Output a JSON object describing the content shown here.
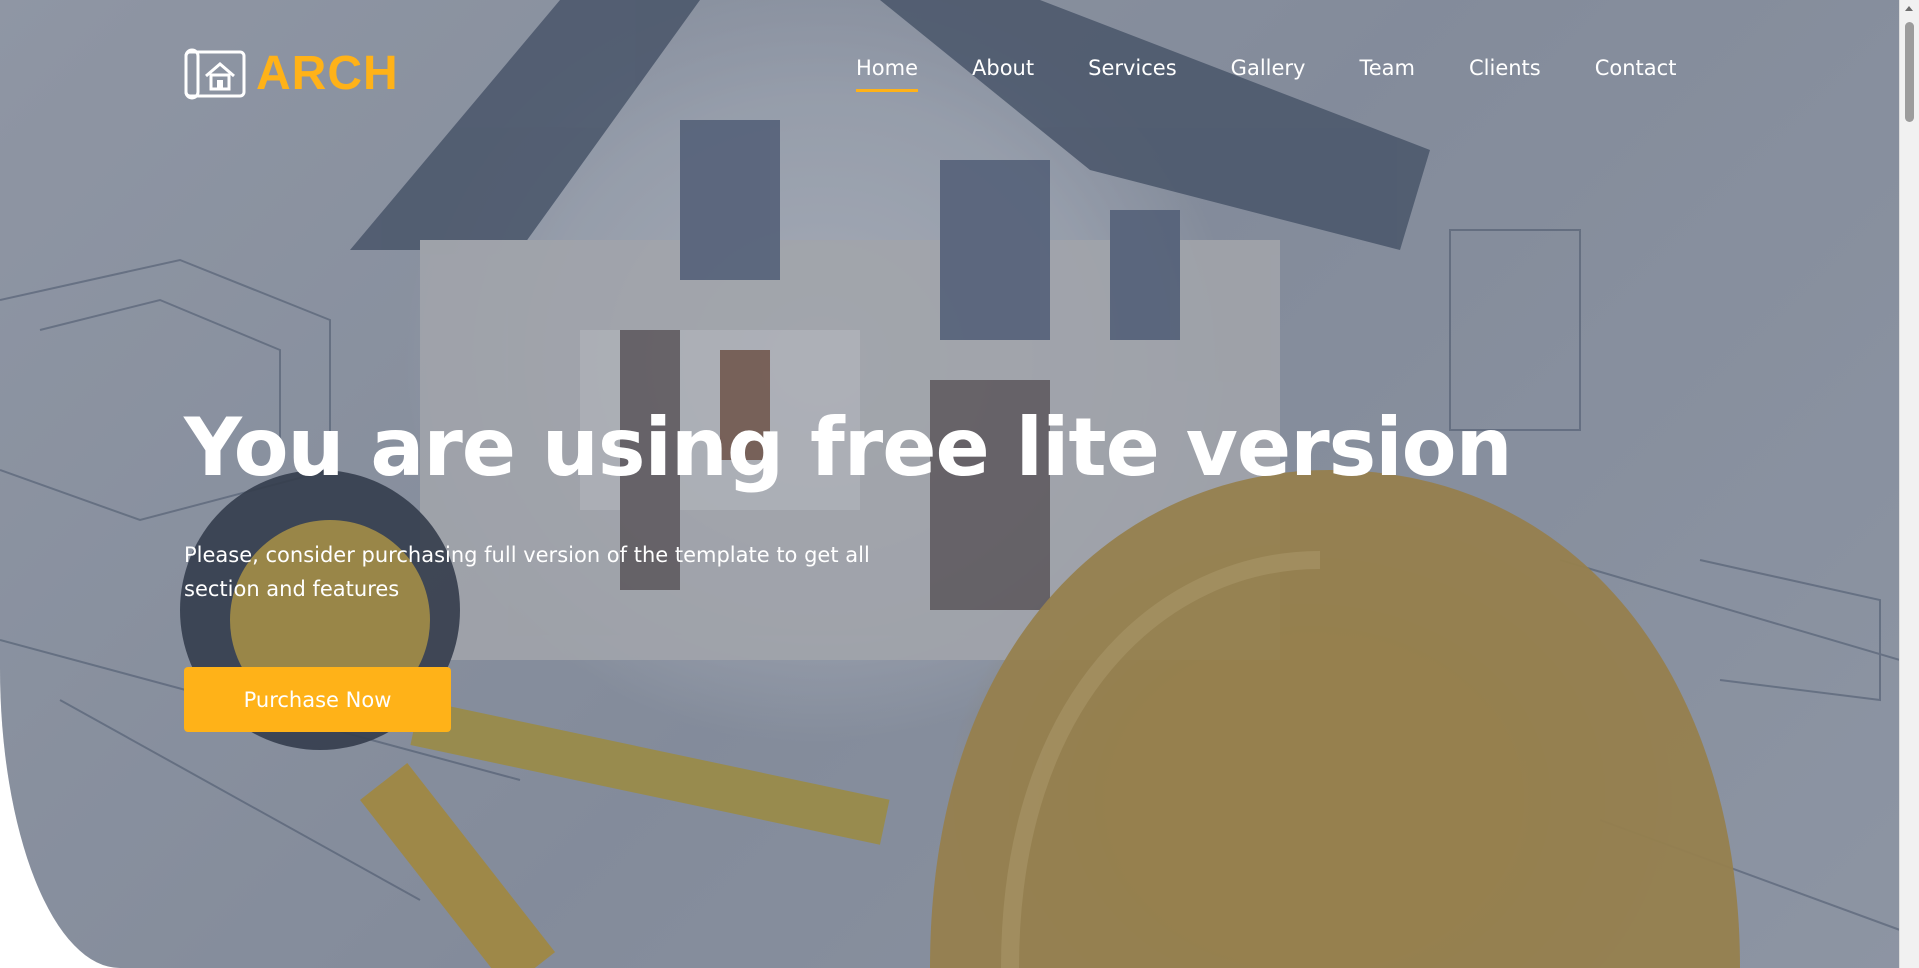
{
  "brand": {
    "name": "ARCH",
    "accent_color": "#ffb218",
    "logo_icon": "blueprint-house-icon"
  },
  "nav": {
    "items": [
      {
        "label": "Home",
        "active": true
      },
      {
        "label": "About"
      },
      {
        "label": "Services"
      },
      {
        "label": "Gallery"
      },
      {
        "label": "Team"
      },
      {
        "label": "Clients"
      },
      {
        "label": "Contact"
      }
    ]
  },
  "hero": {
    "title": "You are using free lite version",
    "subtitle": "Please, consider purchasing full version of the template to get all section and features",
    "cta_label": "Purchase Now"
  }
}
